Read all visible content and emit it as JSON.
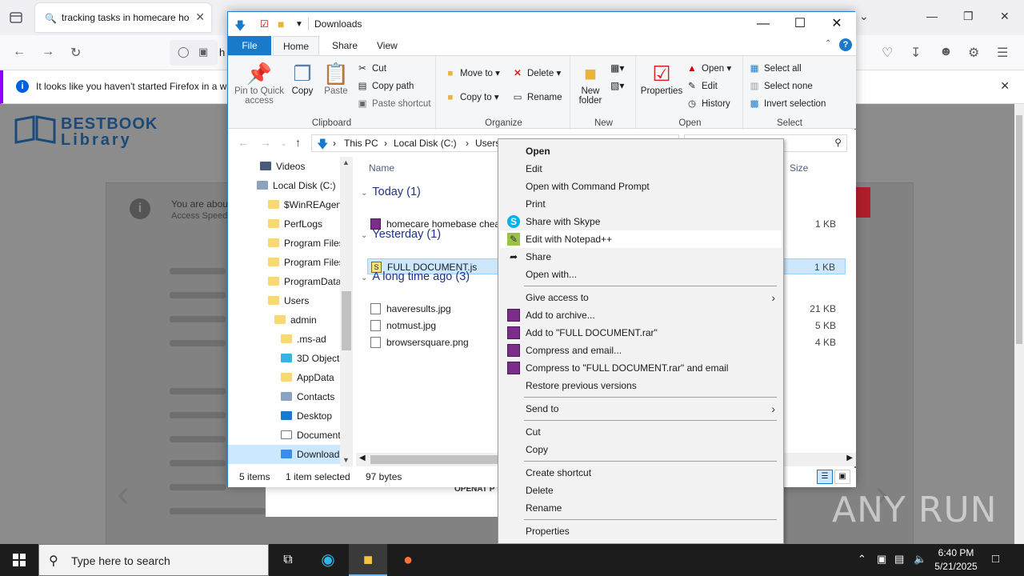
{
  "firefox": {
    "tab_title": "tracking tasks in homecare hom",
    "notification": "It looks like you haven't started Firefox in a w",
    "url_fragment": "h"
  },
  "webpage": {
    "logo_line1": "BESTBOOK",
    "logo_line2": "Library",
    "alert_line1": "You are abou",
    "alert_line2": "Access Speed",
    "dialog_text": "OPENAT P"
  },
  "explorer": {
    "title": "Downloads",
    "tabs": {
      "file": "File",
      "home": "Home",
      "share": "Share",
      "view": "View"
    },
    "ribbon": {
      "clipboard": {
        "label": "Clipboard",
        "pin": "Pin to Quick access",
        "copy": "Copy",
        "paste": "Paste",
        "cut": "Cut",
        "copy_path": "Copy path",
        "paste_shortcut": "Paste shortcut"
      },
      "organize": {
        "label": "Organize",
        "move_to": "Move to",
        "copy_to": "Copy to",
        "delete": "Delete",
        "rename": "Rename"
      },
      "new": {
        "label": "New",
        "new_folder": "New folder"
      },
      "open": {
        "label": "Open",
        "properties": "Properties",
        "open": "Open",
        "edit": "Edit",
        "history": "History"
      },
      "select": {
        "label": "Select",
        "select_all": "Select all",
        "select_none": "Select none",
        "invert": "Invert selection"
      }
    },
    "breadcrumb": {
      "this_pc": "This PC",
      "disk": "Local Disk (C:)",
      "users": "Users"
    },
    "nav_items": [
      "Videos",
      "Local Disk (C:)",
      "$WinREAgent",
      "PerfLogs",
      "Program Files",
      "Program Files",
      "ProgramData",
      "Users",
      "admin",
      ".ms-ad",
      "3D Objects",
      "AppData",
      "Contacts",
      "Desktop",
      "Documents",
      "Downloads"
    ],
    "columns": {
      "name": "Name",
      "size": "Size"
    },
    "groups": {
      "today": "Today (1)",
      "yesterday": "Yesterday (1)",
      "long_ago": "A long time ago (3)"
    },
    "files": [
      {
        "name": "homecare homebase cheat",
        "size": "1 KB"
      },
      {
        "name": "FULL DOCUMENT.js",
        "size": "1 KB"
      },
      {
        "name": "haveresults.jpg",
        "size": "21 KB"
      },
      {
        "name": "notmust.jpg",
        "size": "5 KB"
      },
      {
        "name": "browsersquare.png",
        "size": "4 KB"
      }
    ],
    "status": {
      "count": "5 items",
      "selected": "1 item selected",
      "bytes": "97 bytes"
    }
  },
  "context_menu": {
    "open": "Open",
    "edit": "Edit",
    "open_cmd": "Open with Command Prompt",
    "print": "Print",
    "skype": "Share with Skype",
    "notepad": "Edit with Notepad++",
    "share": "Share",
    "open_with": "Open with...",
    "give_access": "Give access to",
    "add_archive": "Add to archive...",
    "add_rar": "Add to \"FULL DOCUMENT.rar\"",
    "compress_email": "Compress and email...",
    "compress_rar_email": "Compress to \"FULL DOCUMENT.rar\" and email",
    "restore": "Restore previous versions",
    "send_to": "Send to",
    "cut": "Cut",
    "copy": "Copy",
    "create_shortcut": "Create shortcut",
    "delete": "Delete",
    "rename": "Rename",
    "properties": "Properties"
  },
  "taskbar": {
    "search_placeholder": "Type here to search",
    "time": "6:40 PM",
    "date": "5/21/2025"
  },
  "watermark": "ANY RUN",
  "colors": {
    "accent": "#1979ca",
    "selection": "#cce8ff",
    "taskbar": "#1c1c1c"
  }
}
